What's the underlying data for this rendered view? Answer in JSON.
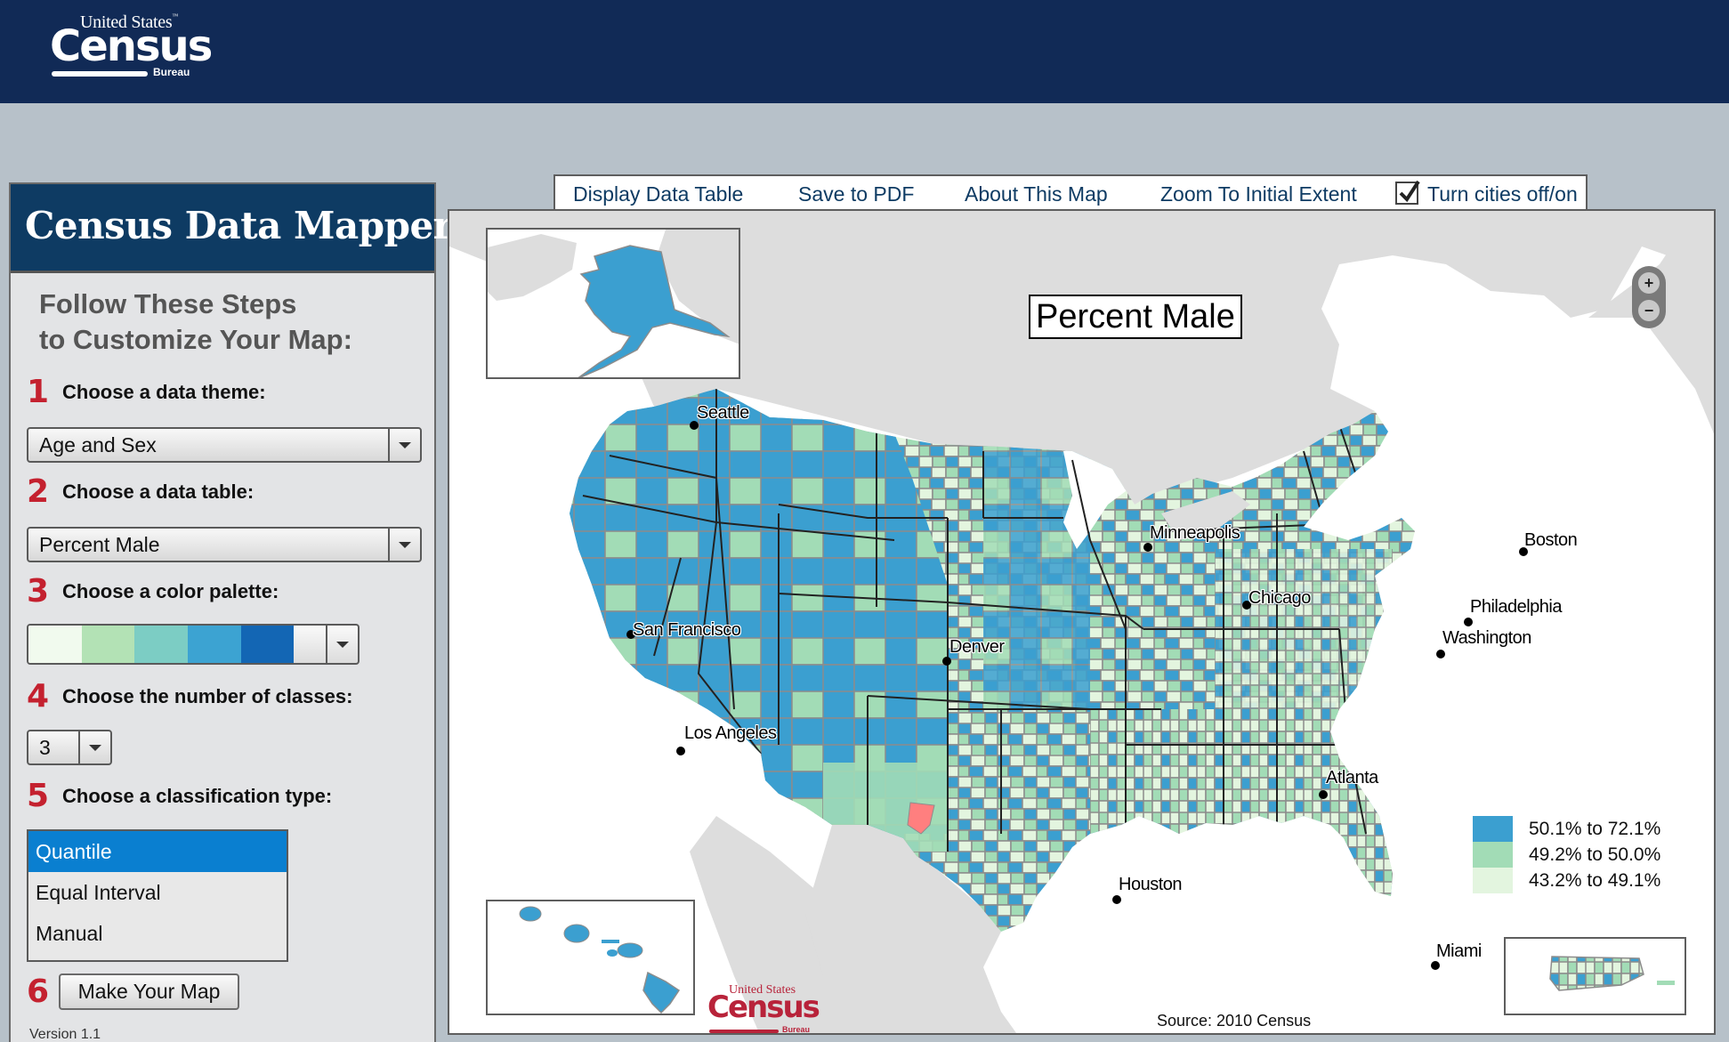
{
  "header": {
    "logo": {
      "line1": "United States",
      "tm": "™",
      "line2": "Census",
      "line3": "Bureau"
    }
  },
  "panel": {
    "title": "Census Data Mapper",
    "steps_heading_line1": "Follow These Steps",
    "steps_heading_line2": "to Customize Your Map:",
    "steps": [
      {
        "num": "1",
        "label": "Choose a data theme:"
      },
      {
        "num": "2",
        "label": "Choose a data table:"
      },
      {
        "num": "3",
        "label": "Choose a color palette:"
      },
      {
        "num": "4",
        "label": "Choose the number of classes:"
      },
      {
        "num": "5",
        "label": "Choose a classification type:"
      },
      {
        "num": "6"
      }
    ],
    "theme_select": {
      "value": "Age and Sex"
    },
    "table_select": {
      "value": "Percent Male"
    },
    "palette": {
      "colors": [
        "#f1faee",
        "#b3e2b5",
        "#7ccdc4",
        "#3ca3d2",
        "#1366b4"
      ]
    },
    "classes_select": {
      "value": "3"
    },
    "classification_options": [
      {
        "label": "Quantile",
        "selected": true
      },
      {
        "label": "Equal Interval",
        "selected": false
      },
      {
        "label": "Manual",
        "selected": false
      }
    ],
    "make_map_button": "Make Your Map",
    "version": "Version 1.1"
  },
  "toolbar": {
    "display_data_table": "Display Data Table",
    "save_to_pdf": "Save to PDF",
    "about_this_map": "About This Map",
    "zoom_initial_extent": "Zoom To Initial Extent",
    "cities_toggle": {
      "label": "Turn cities off/on",
      "checked": true
    }
  },
  "map": {
    "title": "Percent Male",
    "source": "Source:  2010 Census",
    "zoom_in": "+",
    "zoom_out": "−",
    "colors": {
      "high": "#3b9fd0",
      "mid": "#a2dcb6",
      "low": "#e3f5df",
      "no_data": "#ff7f7f",
      "land_other": "#dddddd",
      "water": "#ffffff",
      "county_border": "#8c8c8c",
      "state_border": "#222222"
    },
    "legend": [
      {
        "label": "50.1% to 72.1%",
        "color": "#3b9fd0"
      },
      {
        "label": "49.2% to 50.0%",
        "color": "#a2dcb6"
      },
      {
        "label": "43.2% to 49.1%",
        "color": "#e3f5df"
      }
    ],
    "cities": [
      {
        "name": "Seattle"
      },
      {
        "name": "San Francisco"
      },
      {
        "name": "Los Angeles"
      },
      {
        "name": "Denver"
      },
      {
        "name": "Minneapolis"
      },
      {
        "name": "Chicago"
      },
      {
        "name": "Boston"
      },
      {
        "name": "Philadelphia"
      },
      {
        "name": "Washington"
      },
      {
        "name": "Atlanta"
      },
      {
        "name": "Houston"
      },
      {
        "name": "Miami"
      }
    ],
    "insets": [
      "Alaska",
      "Hawaii",
      "Puerto Rico"
    ],
    "watermark": {
      "line1": "United States",
      "line2": "Census",
      "line3": "Bureau"
    }
  }
}
